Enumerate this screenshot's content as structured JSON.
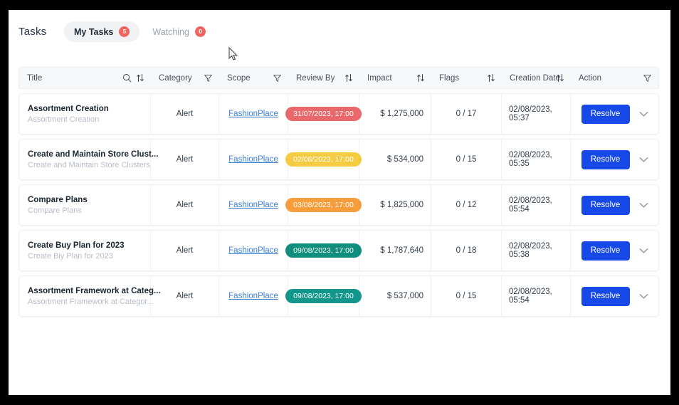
{
  "header": {
    "title": "Tasks",
    "tabs": [
      {
        "label": "My Tasks",
        "badge": "5",
        "active": true
      },
      {
        "label": "Watching",
        "badge": "0",
        "active": false
      }
    ]
  },
  "table": {
    "columns": [
      {
        "key": "title",
        "label": "Title",
        "icons": [
          "search-icon",
          "sort-icon"
        ]
      },
      {
        "key": "category",
        "label": "Category",
        "icons": [
          "filter-icon"
        ]
      },
      {
        "key": "scope",
        "label": "Scope",
        "icons": [
          "filter-icon"
        ]
      },
      {
        "key": "review",
        "label": "Review By",
        "icons": [
          "sort-icon"
        ]
      },
      {
        "key": "impact",
        "label": "Impact",
        "icons": [
          "sort-icon"
        ]
      },
      {
        "key": "flags",
        "label": "Flags",
        "icons": [
          "sort-icon"
        ]
      },
      {
        "key": "created",
        "label": "Creation Date",
        "icons": [
          "sort-icon"
        ]
      },
      {
        "key": "action",
        "label": "Action",
        "icons": [
          "filter-icon"
        ]
      }
    ],
    "rows": [
      {
        "title": "Assortment Creation",
        "subtitle": "Assortment Creation",
        "category": "Alert",
        "scope": "FashionPlace",
        "review_by": "31/07/2023, 17:00",
        "review_color": "#e8686c",
        "impact": "$ 1,275,000",
        "flags": "0 / 17",
        "creation_date": "02/08/2023, 05:37",
        "action_label": "Resolve"
      },
      {
        "title": "Create and Maintain Store Clust...",
        "subtitle": "Create and Maintain Store Clusters",
        "category": "Alert",
        "scope": "FashionPlace",
        "review_by": "02/08/2023, 17:00",
        "review_color": "#f5cb42",
        "impact": "$ 534,000",
        "flags": "0 / 15",
        "creation_date": "02/08/2023, 05:35",
        "action_label": "Resolve"
      },
      {
        "title": "Compare Plans",
        "subtitle": "Compare Plans",
        "category": "Alert",
        "scope": "FashionPlace",
        "review_by": "03/08/2023, 17:00",
        "review_color": "#f79d3c",
        "impact": "$ 1,825,000",
        "flags": "0 / 12",
        "creation_date": "02/08/2023, 05:54",
        "action_label": "Resolve"
      },
      {
        "title": "Create Buy Plan for 2023",
        "subtitle": "Create Biy Plan for 2023",
        "category": "Alert",
        "scope": "FashionPlace",
        "review_by": "09/08/2023, 17:00",
        "review_color": "#0f8d7d",
        "impact": "$ 1,787,640",
        "flags": "0 / 18",
        "creation_date": "02/08/2023, 05:38",
        "action_label": "Resolve"
      },
      {
        "title": "Assortment Framework at Categ...",
        "subtitle": "Assortment Framework at Categor...",
        "category": "Alert",
        "scope": "FashionPlace",
        "review_by": "09/08/2023, 17:00",
        "review_color": "#12958a",
        "impact": "$ 537,000",
        "flags": "0 / 15",
        "creation_date": "02/08/2023, 05:54",
        "action_label": "Resolve"
      }
    ]
  },
  "colors": {
    "primary": "#1749e8",
    "link": "#3b7ddd",
    "badge": "#f2655e",
    "header_bg": "#f7f8f9"
  }
}
